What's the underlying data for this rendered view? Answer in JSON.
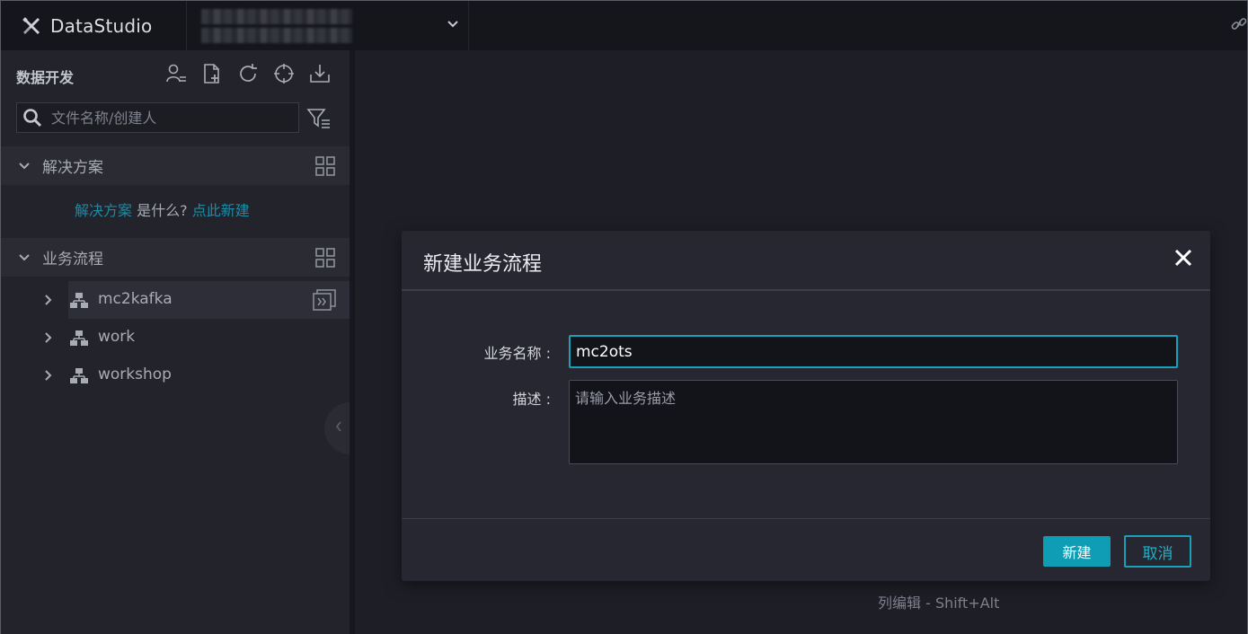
{
  "app": {
    "name": "DataStudio"
  },
  "topbar": {
    "project_icon": "chevron-down-icon",
    "link_icon": "link-icon"
  },
  "sidebar": {
    "title": "数据开发",
    "search_placeholder": "文件名称/创建人",
    "sections": [
      {
        "label": "解决方案"
      },
      {
        "label": "业务流程"
      }
    ],
    "solution_hint": {
      "link": "解决方案",
      "text": " 是什么? ",
      "action": "点此新建"
    },
    "tree": [
      {
        "label": "mc2kafka",
        "selected": true
      },
      {
        "label": "work",
        "selected": false
      },
      {
        "label": "workshop",
        "selected": false
      }
    ]
  },
  "modal": {
    "title": "新建业务流程",
    "name_label": "业务名称 :",
    "name_value": "mc2ots",
    "desc_label": "描述 :",
    "desc_placeholder": "请输入业务描述",
    "create_label": "新建",
    "cancel_label": "取消"
  },
  "footer_hint": "列编辑 - Shift+Alt",
  "colors": {
    "accent": "#1aa0b8",
    "link": "#1b8ba6",
    "background": "#1e1f26"
  }
}
